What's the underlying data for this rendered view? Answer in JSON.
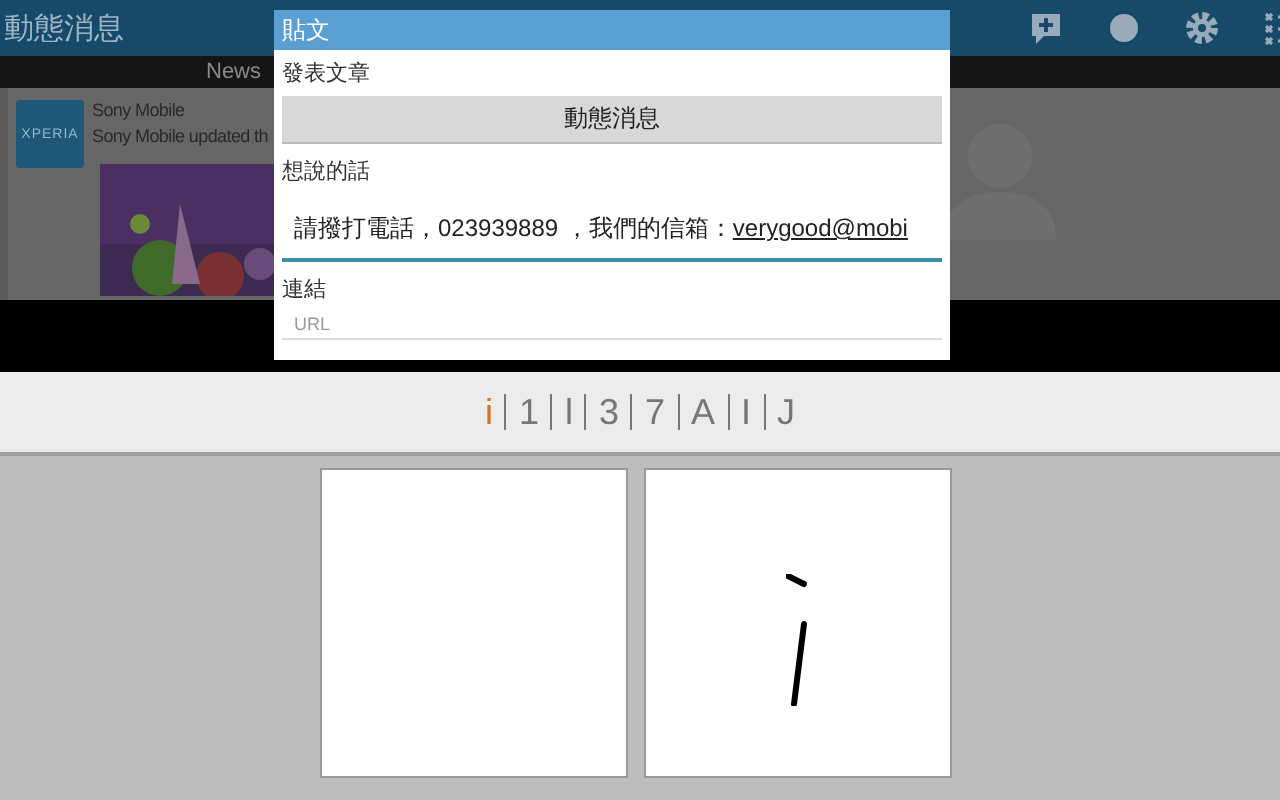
{
  "app_bar": {
    "title": "動態消息"
  },
  "news_tab": {
    "label": "News"
  },
  "feed_item": {
    "logo": "XPERIA",
    "author": "Sony Mobile",
    "text": "Sony Mobile updated th"
  },
  "dialog": {
    "title": "貼文",
    "post_type_label": "發表文章",
    "post_type_button": "動態消息",
    "message_label": "想說的話",
    "message": {
      "text": "請撥打電話，023939889 ，我們的信箱：",
      "underlined": "verygood@mobi"
    },
    "link_label": "連結",
    "link": {
      "placeholder": "URL"
    }
  },
  "candidates": [
    {
      "label": "i",
      "selected": true
    },
    {
      "label": "1",
      "selected": false
    },
    {
      "label": "l",
      "selected": false
    },
    {
      "label": "3",
      "selected": false
    },
    {
      "label": "7",
      "selected": false
    },
    {
      "label": "A",
      "selected": false
    },
    {
      "label": "I",
      "selected": false
    },
    {
      "label": "J",
      "selected": false
    }
  ],
  "writing_panels": [
    {
      "kind": "empty"
    },
    {
      "kind": "ink"
    }
  ]
}
